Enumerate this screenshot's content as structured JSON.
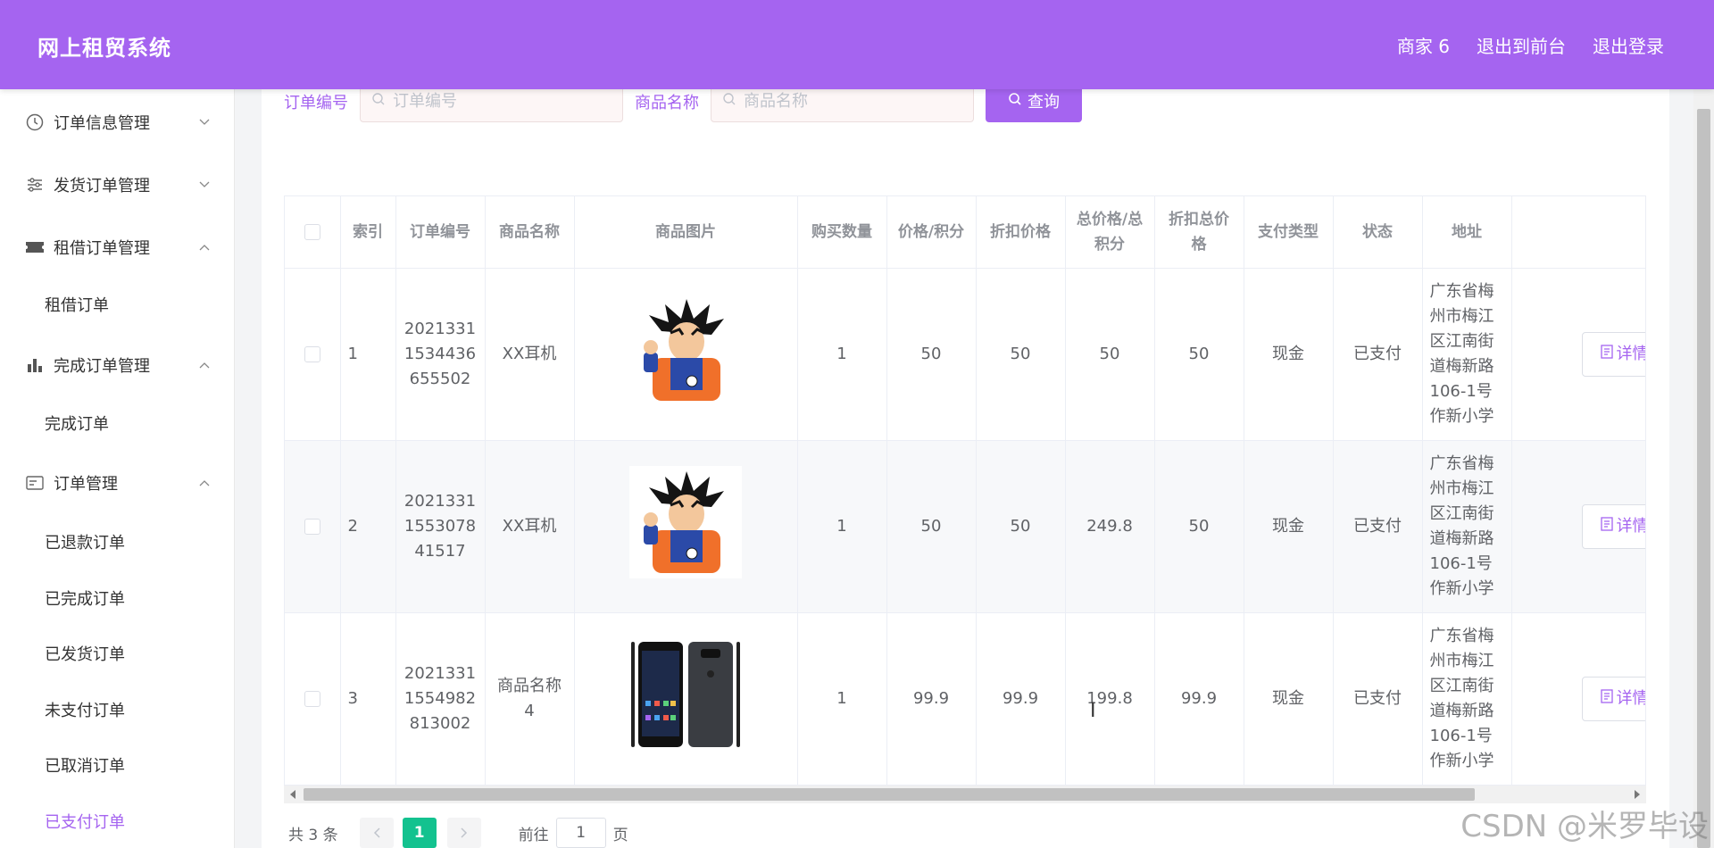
{
  "header": {
    "brand": "网上租贸系统",
    "nav": [
      "商家 6",
      "退出到前台",
      "退出登录"
    ]
  },
  "sidebar": {
    "groups": [
      {
        "label": "订单信息管理",
        "icon": "clock-icon",
        "expanded": false
      },
      {
        "label": "发货订单管理",
        "icon": "sliders-icon",
        "expanded": false
      },
      {
        "label": "租借订单管理",
        "icon": "ticket-icon",
        "expanded": true
      },
      {
        "label": "完成订单管理",
        "icon": "bar-chart-icon",
        "expanded": true
      },
      {
        "label": "订单管理",
        "icon": "id-card-icon",
        "expanded": true
      }
    ],
    "subitems": {
      "rent": "租借订单",
      "complete": "完成订单",
      "orders": [
        "已退款订单",
        "已完成订单",
        "已发货订单",
        "未支付订单",
        "已取消订单",
        "已支付订单"
      ]
    },
    "active_item": "已支付订单"
  },
  "search": {
    "order_label": "订单编号",
    "order_placeholder": "订单编号",
    "product_label": "商品名称",
    "product_placeholder": "商品名称",
    "button_label": "查询"
  },
  "table": {
    "headers": [
      "索引",
      "订单编号",
      "商品名称",
      "商品图片",
      "购买数量",
      "价格/积分",
      "折扣价格",
      "总价格/总积分",
      "折扣总价格",
      "支付类型",
      "状态",
      "地址"
    ],
    "detail_label": "详情",
    "rows": [
      {
        "index": "1",
        "order_no": "20213311534436655502",
        "product": "XX耳机",
        "image": "goku-image",
        "qty": "1",
        "price": "50",
        "discount_price": "50",
        "total": "50",
        "discount_total": "50",
        "pay_type": "现金",
        "status": "已支付",
        "address": "广东省梅州市梅江区江南街道梅新路106-1号作新小学"
      },
      {
        "index": "2",
        "order_no": "2021331155307841517",
        "product": "XX耳机",
        "image": "goku-image",
        "qty": "1",
        "price": "50",
        "discount_price": "50",
        "total": "249.8",
        "discount_total": "50",
        "pay_type": "现金",
        "status": "已支付",
        "address": "广东省梅州市梅江区江南街道梅新路106-1号作新小学"
      },
      {
        "index": "3",
        "order_no": "20213311554982813002",
        "product": "商品名称4",
        "image": "phone-image",
        "qty": "1",
        "price": "99.9",
        "discount_price": "99.9",
        "total": "199.8",
        "discount_total": "99.9",
        "pay_type": "现金",
        "status": "已支付",
        "address": "广东省梅州市梅江区江南街道梅新路106-1号作新小学"
      }
    ]
  },
  "pagination": {
    "total_text": "共 3 条",
    "current_page": "1",
    "goto_prefix": "前往",
    "goto_value": "1",
    "goto_suffix": "页"
  },
  "watermark": "CSDN @米罗毕设",
  "colors": {
    "accent": "#a564f0",
    "page_active": "#13c28f"
  }
}
